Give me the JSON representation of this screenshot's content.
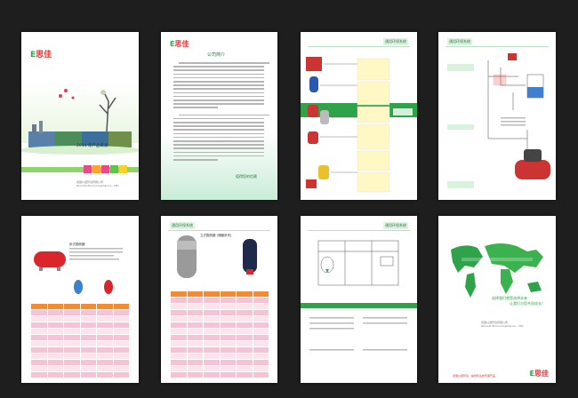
{
  "brand": {
    "logo_e": "E",
    "logo_text": "思佳"
  },
  "cover": {
    "title": "2014 年产品目录",
    "company_cn": "德国以诺环境有限公司",
    "company_en": "Dinuohi Environmental Co., LTD"
  },
  "intro": {
    "title": "公司简介",
    "footer": "值得您的信赖"
  },
  "section_header": "通用环保系统",
  "products": {
    "label_a": "立式膨胀罐 (储罐系列)",
    "label_b": "卧式膨胀罐"
  },
  "back": {
    "slogan_1": "选择我们就是选择未来",
    "slogan_2": "让我们与您共同成长！",
    "company_cn": "德国以诺环境有限公司",
    "company_en": "Dinuohi Environmental Co., LTD",
    "footer_red": "德国以诺环境 · 提供专业的环保产品"
  },
  "colors": {
    "brand_green": "#2aa84a",
    "band_green": "#8fd36c",
    "table_orange": "#f38b32",
    "table_pink": "#f6c3d4",
    "accent_red": "#d9262b"
  }
}
